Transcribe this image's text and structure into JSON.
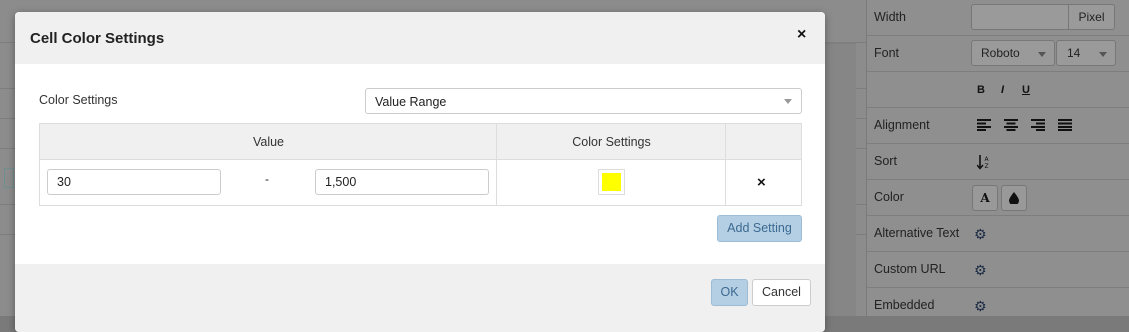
{
  "dialog": {
    "title": "Cell Color Settings",
    "close_icon": "×",
    "color_settings_label": "Color Settings",
    "mode_select": {
      "value": "Value Range"
    },
    "table": {
      "headers": [
        "Value",
        "Color Settings",
        ""
      ],
      "rows": [
        {
          "from": "30",
          "separator": "-",
          "to": "1,500",
          "color": "#ffff00",
          "delete_icon": "×"
        }
      ]
    },
    "add_button": "Add Setting",
    "ok_button": "OK",
    "cancel_button": "Cancel"
  },
  "properties": {
    "width": {
      "label": "Width",
      "value": "",
      "unit_button": "Pixel"
    },
    "font": {
      "label": "Font",
      "family": "Roboto",
      "size": "14"
    },
    "style_buttons": [
      "B",
      "I",
      "U"
    ],
    "alignment": {
      "label": "Alignment"
    },
    "sort": {
      "label": "Sort"
    },
    "color": {
      "label": "Color",
      "text_color_glyph": "A"
    },
    "alternative_text": {
      "label": "Alternative Text"
    },
    "custom_url": {
      "label": "Custom URL"
    },
    "embedded": {
      "label": "Embedded"
    }
  },
  "colors": {
    "accent": "#b4cfe3",
    "accent_text": "#3d6a92",
    "swatch": "#ffff00"
  }
}
